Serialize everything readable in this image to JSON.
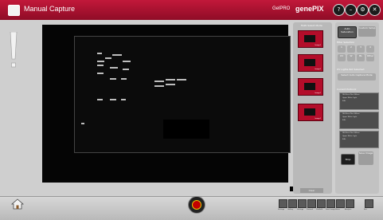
{
  "titlebar": {
    "title": "Manual Capture",
    "brand_small": "GelPRO",
    "brand_large": "genePIX",
    "buttons": [
      "?",
      "–",
      "⚙",
      "✕"
    ]
  },
  "side_panel": {
    "label": "Multi Select Mode",
    "thumb_caption": "Image1",
    "bottom_button": "Clear"
  },
  "right_panel": {
    "btn_auto": "Auto Saturation",
    "btn_custom": "Custom Setup",
    "section_filter": "Filter Selection",
    "filters_row1": [
      "1",
      "2",
      "3",
      "4"
    ],
    "filters_row2": [
      "UV",
      "W",
      "BL",
      "Other"
    ],
    "section_uv": "UV Lights Not Selected",
    "btn_select": "Select Auto Capture Mode",
    "section_protocol": "Current Protocol",
    "protocols": [
      [
        "DE-Kleen Plus 365nm",
        "Upper White Light",
        "EtBr"
      ],
      [
        "DE-Kleen Plus 365nm",
        "Upper White Light",
        "EtBr"
      ],
      [
        "DE-Kleen Plus 365nm",
        "Upper White Light",
        "EtBr"
      ]
    ],
    "btn_stop": "Stop",
    "btn_save": "Save Image"
  },
  "toolbar": {
    "labels": [
      "Settings",
      "Gallery",
      "Settings",
      "Protocol",
      "Flatfield",
      "Save Image",
      "Notes",
      "Analysis",
      "Exit"
    ]
  }
}
